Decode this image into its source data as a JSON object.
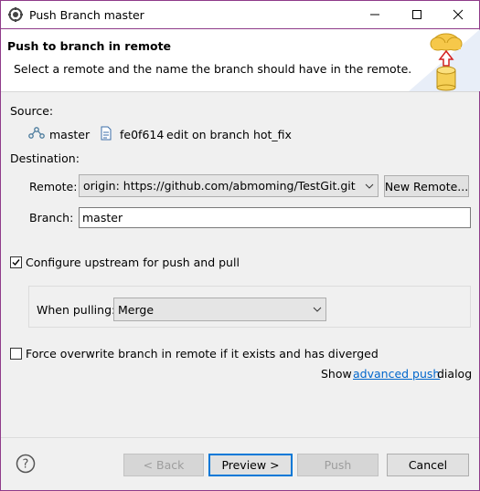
{
  "window": {
    "title": "Push Branch master"
  },
  "banner": {
    "title": "Push to branch in remote",
    "message": "Select a remote and the name the branch should have in the remote."
  },
  "source": {
    "label": "Source:",
    "branch": "master",
    "commit_id": "fe0f614",
    "commit_message": "edit on branch hot_fix"
  },
  "destination": {
    "label": "Destination:",
    "remote_label": "Remote:",
    "remote_value": "origin: https://github.com/abmoming/TestGit.git",
    "new_remote_button": "New Remote...",
    "branch_label": "Branch:",
    "branch_value": "master"
  },
  "upstream": {
    "checked": true,
    "label": "Configure upstream for push and pull",
    "when_pulling_label": "When pulling:",
    "when_pulling_value": "Merge"
  },
  "force": {
    "checked": false,
    "label": "Force overwrite branch in remote if it exists and has diverged"
  },
  "advanced": {
    "prefix": "Show",
    "link": "advanced push",
    "suffix": "dialog"
  },
  "buttons": {
    "back": "< Back",
    "preview": "Preview >",
    "push": "Push",
    "cancel": "Cancel"
  },
  "colors": {
    "accent": "#0078d7",
    "window_border": "#8f3b8a",
    "link": "#0066cc"
  }
}
